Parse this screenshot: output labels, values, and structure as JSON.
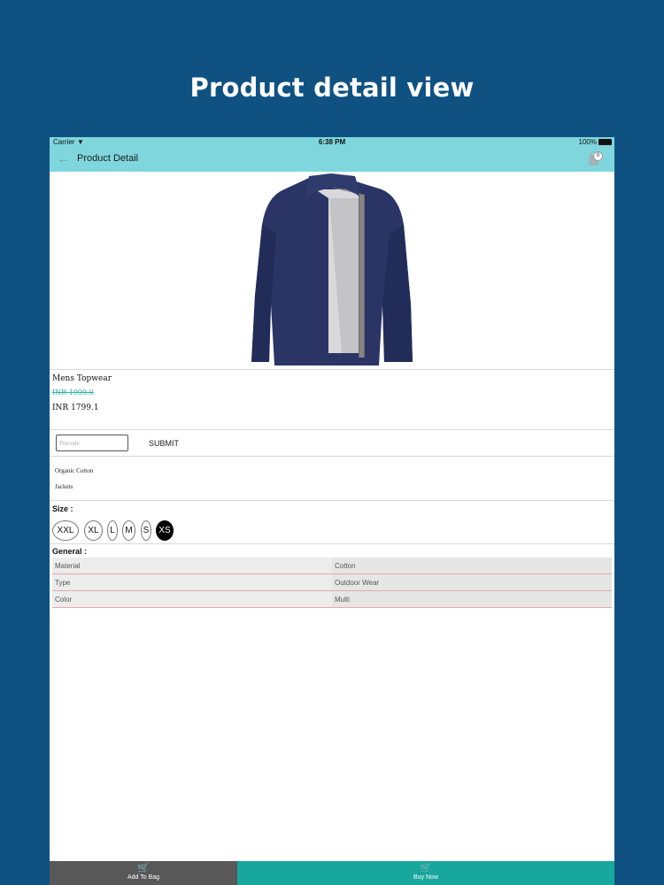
{
  "promo": {
    "title": "Product detail view"
  },
  "status_bar": {
    "carrier": "Carrier",
    "time": "6:38 PM",
    "battery": "100%"
  },
  "header": {
    "title": "Product Detail",
    "bag_count": "0"
  },
  "product": {
    "image_alt": "Navy blue mens jacket",
    "category": "Mens Topwear",
    "old_price": "INR 1999.0",
    "price": "INR 1799.1"
  },
  "pincode": {
    "placeholder": "Pincode",
    "submit_label": "SUBMIT"
  },
  "tags": [
    "Organic Cotton",
    "Jackets"
  ],
  "sizes": {
    "heading": "Size :",
    "options": [
      "XXL",
      "XL",
      "L",
      "M",
      "S",
      "XS"
    ],
    "selected": "XS"
  },
  "general": {
    "heading": "General :",
    "rows": [
      {
        "key": "Material",
        "value": "Cotton"
      },
      {
        "key": "Type",
        "value": "Outdoor Wear"
      },
      {
        "key": "Color",
        "value": "Multi"
      }
    ]
  },
  "actions": {
    "add_to_bag": "Add To Bag",
    "buy_now": "Buy Now"
  },
  "colors": {
    "background": "#0f5282",
    "nav": "#7fd7dd",
    "accent": "#17a79e",
    "add_to_bag": "#585858"
  }
}
